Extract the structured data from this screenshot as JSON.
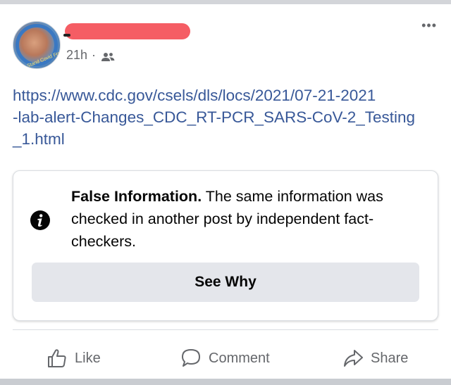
{
  "post": {
    "author_name": "",
    "timestamp": "21h",
    "separator": "·",
    "audience_icon": "friends-icon",
    "more_label": "•••",
    "avatar_ring_text": "We Stand Covid Free",
    "link_lines": [
      "https://www.cdc.gov/csels/dls/locs/2021/07-21-2021",
      "-lab-alert-Changes_CDC_RT-PCR_SARS-CoV-2_Testing",
      "_1.html"
    ]
  },
  "fact_check": {
    "icon": "info-icon",
    "label_bold": "False Information.",
    "label_text": " The same information was checked in another post by independent fact-checkers.",
    "button_label": "See Why"
  },
  "actions": {
    "like_label": "Like",
    "comment_label": "Comment",
    "share_label": "Share",
    "like_icon": "thumbs-up-icon",
    "comment_icon": "comment-bubble-icon",
    "share_icon": "share-arrow-icon"
  },
  "colors": {
    "link": "#385898",
    "redaction": "#f55d64",
    "button_bg": "#e4e6eb",
    "secondary_text": "#65676b"
  }
}
